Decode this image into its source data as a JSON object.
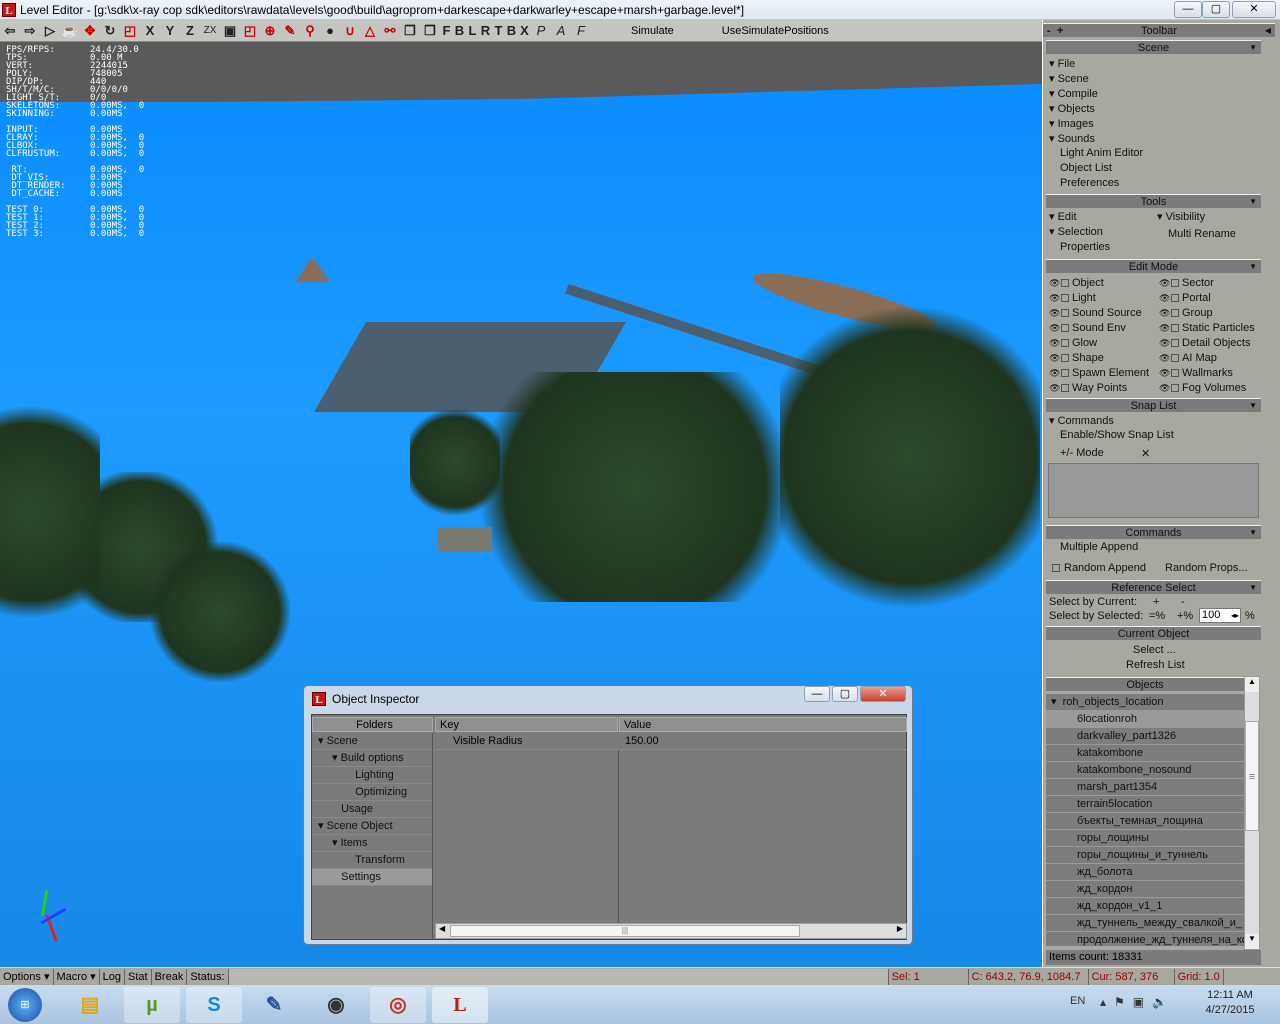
{
  "window": {
    "title": "Level Editor - [g:\\sdk\\x-ray cop sdk\\editors\\rawdata\\levels\\good\\build\\agroprom+darkescape+darkwarley+escape+marsh+garbage.level*]",
    "app_icon": "L",
    "minimize": "—",
    "maximize": "▢",
    "close": "✕"
  },
  "toolbar": {
    "icons": [
      "arrow-left-icon",
      "arrow-right-icon",
      "select-pointer-icon",
      "add-icon",
      "move-icon",
      "rotate-icon",
      "scale-icon"
    ],
    "axis": [
      "X",
      "Y",
      "Z",
      "ZX"
    ],
    "views": [
      "F",
      "B",
      "L",
      "R",
      "T",
      "B",
      "X"
    ],
    "simulate": "Simulate",
    "use_simulate_positions": "UseSimulatePositions"
  },
  "stats": [
    [
      "FPS/RFPS:",
      "24.4/30.0"
    ],
    [
      "TPS:",
      "0.00 M"
    ],
    [
      "VERT:",
      "2244015"
    ],
    [
      "POLY:",
      "748005"
    ],
    [
      "DIP/DP:",
      "440"
    ],
    [
      "SH/T/M/C:",
      "0/0/0/0"
    ],
    [
      "LIGHT S/T:",
      "0/0"
    ],
    [
      "SKELETONS:",
      "0.00MS,  0"
    ],
    [
      "SKINNING:",
      "0.00MS"
    ],
    [
      "",
      ""
    ],
    [
      "INPUT:",
      "0.00MS"
    ],
    [
      "CLRAY:",
      "0.00MS,  0"
    ],
    [
      "CLBOX:",
      "0.00MS,  0"
    ],
    [
      "CLFRUSTUM:",
      "0.00MS,  0"
    ],
    [
      "",
      ""
    ],
    [
      " RT:",
      "0.00MS,  0"
    ],
    [
      " DT_VIS:",
      "0.00MS"
    ],
    [
      " DT_RENDER:",
      "0.00MS"
    ],
    [
      " DT_CACHE:",
      "0.00MS"
    ],
    [
      "",
      ""
    ],
    [
      "TEST 0:",
      "0.00MS,  0"
    ],
    [
      "TEST 1:",
      "0.00MS,  0"
    ],
    [
      "TEST 2:",
      "0.00MS,  0"
    ],
    [
      "TEST 3:",
      "0.00MS,  0"
    ]
  ],
  "panel": {
    "toolbar_title": "Toolbar",
    "toolbar_minus": "-",
    "toolbar_plus": "+",
    "scene": {
      "title": "Scene",
      "items": [
        "File",
        "Scene",
        "Compile",
        "Objects",
        "Images",
        "Sounds"
      ],
      "plain": [
        "Light Anim Editor",
        "Object List",
        "Preferences"
      ]
    },
    "tools": {
      "title": "Tools",
      "edit": "Edit",
      "selection": "Selection",
      "properties": "Properties",
      "visibility": "Visibility",
      "multi_rename": "Multi Rename"
    },
    "edit_mode": {
      "title": "Edit Mode",
      "left": [
        "Object",
        "Light",
        "Sound Source",
        "Sound Env",
        "Glow",
        "Shape",
        "Spawn Element",
        "Way Points"
      ],
      "right": [
        "Sector",
        "Portal",
        "Group",
        "Static Particles",
        "Detail Objects",
        "AI Map",
        "Wallmarks",
        "Fog Volumes"
      ]
    },
    "snap": {
      "title": "Snap List",
      "commands": "Commands",
      "enable": "Enable/Show Snap List",
      "mode": "+/- Mode",
      "x": "✕"
    },
    "commands": {
      "title": "Commands",
      "multiple_append": "Multiple Append",
      "random_append": "Random Append",
      "random_props": "Random Props..."
    },
    "ref": {
      "title": "Reference Select",
      "by_current": "Select by Current:",
      "plus": "+",
      "minus": "-",
      "by_selected": "Select by Selected:",
      "eq": "=%",
      "pluspct": "+%",
      "value": "100",
      "pct": "%"
    },
    "current": {
      "title": "Current Object",
      "select": "Select ...",
      "refresh": "Refresh List"
    },
    "objects": {
      "title": "Objects",
      "root": "roh_objects_location",
      "items": [
        "6locationroh",
        "darkvalley_part1326",
        "katakombone",
        "katakombone_nosound",
        "marsh_part1354",
        "terrain5location",
        "бъекты_темная_лощина",
        "горы_лощины",
        "горы_лощины_и_туннель",
        "жд_болота",
        "жд_кордон",
        "жд_кордон_v1_1",
        "жд_туннель_между_свалкой_и_",
        "продолжение_жд_туннеля_на_ко"
      ],
      "count": "Items count: 18331"
    }
  },
  "inspector": {
    "title": "Object Inspector",
    "folders_header": "Folders",
    "key_header": "Key",
    "value_header": "Value",
    "folders": [
      {
        "label": "Scene",
        "lvl": 0,
        "exp": true
      },
      {
        "label": "Build options",
        "lvl": 1,
        "exp": true
      },
      {
        "label": "Lighting",
        "lvl": 2
      },
      {
        "label": "Optimizing",
        "lvl": 2
      },
      {
        "label": "Usage",
        "lvl": 1
      },
      {
        "label": "Scene Object",
        "lvl": 0,
        "exp": true
      },
      {
        "label": "Items",
        "lvl": 1,
        "exp": true
      },
      {
        "label": "Transform",
        "lvl": 2
      },
      {
        "label": "Settings",
        "lvl": 1,
        "sel": true
      }
    ],
    "key": "Visible Radius",
    "value": "150.00"
  },
  "status": {
    "options": "Options",
    "macro": "Macro",
    "log": "Log",
    "stat": "Stat",
    "break": "Break",
    "status": "Status:",
    "sel": "Sel: 1",
    "coords": "C: 643.2, 76.9, 1084.7",
    "cursor": "Cur: 587, 376",
    "grid": "Grid: 1.0"
  },
  "taskbar": {
    "lang": "EN",
    "time": "12:11 AM",
    "date": "4/27/2015",
    "apps": [
      "explorer-icon",
      "utorrent-icon",
      "skype-icon",
      "paint-icon",
      "camera-icon",
      "chrome-icon",
      "level-editor-icon"
    ]
  }
}
